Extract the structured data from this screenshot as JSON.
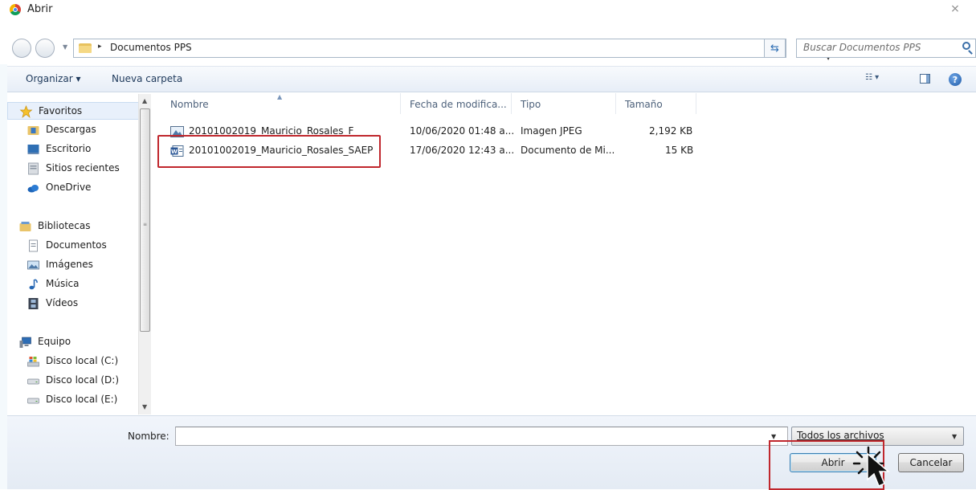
{
  "window": {
    "title": "Abrir",
    "close_glyph": "⨯"
  },
  "address": {
    "path_arrow": "▸",
    "path": "Documentos PPS",
    "search_placeholder": "Buscar Documentos PPS"
  },
  "toolbar": {
    "organize": "Organizar ▾",
    "new_folder": "Nueva carpeta",
    "view_glyph": "☷ ▾",
    "help_glyph": "?"
  },
  "nav": {
    "favorites": {
      "label": "Favoritos",
      "items": [
        "Descargas",
        "Escritorio",
        "Sitios recientes",
        "OneDrive"
      ]
    },
    "libraries": {
      "label": "Bibliotecas",
      "items": [
        "Documentos",
        "Imágenes",
        "Música",
        "Vídeos"
      ]
    },
    "computer": {
      "label": "Equipo",
      "items": [
        "Disco local (C:)",
        "Disco local (D:)",
        "Disco local (E:)"
      ]
    }
  },
  "columns": {
    "name": "Nombre",
    "date": "Fecha de modifica...",
    "type": "Tipo",
    "size": "Tamaño"
  },
  "files": [
    {
      "name": "20101002019_Mauricio_Rosales_F",
      "date": "10/06/2020 01:48 a...",
      "type": "Imagen JPEG",
      "size": "2,192 KB",
      "icon": "image-icon"
    },
    {
      "name": "20101002019_Mauricio_Rosales_SAEP",
      "date": "17/06/2020 12:43 a...",
      "type": "Documento de Mi...",
      "size": "15 KB",
      "icon": "word-doc-icon"
    }
  ],
  "bottom": {
    "name_label": "Nombre:",
    "name_value": "",
    "filter": "Todos los archivos",
    "open_button": "Abrir",
    "cancel_button": "Cancelar"
  },
  "colors": {
    "highlight": "#c0272d",
    "toolbar": "#e7eef7",
    "selected_nav": "#e8f0fb"
  }
}
